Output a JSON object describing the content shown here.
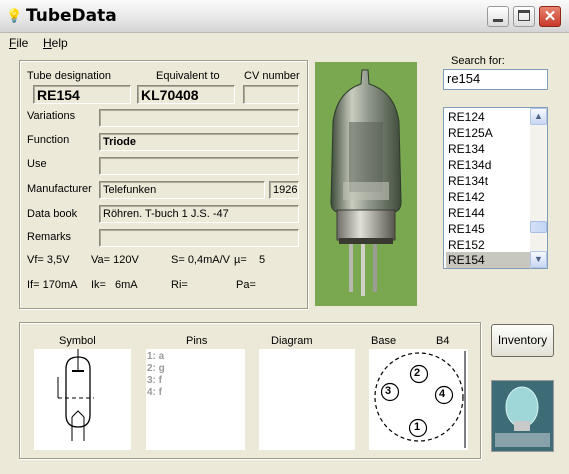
{
  "window": {
    "title": "TubeData"
  },
  "menu": [
    {
      "label": "File",
      "mnemonic": "F",
      "rest": "ile"
    },
    {
      "label": "Help",
      "mnemonic": "H",
      "rest": "elp"
    }
  ],
  "header_labels": {
    "designation": "Tube designation",
    "equivalent": "Equivalent to",
    "cv": "CV number"
  },
  "fields": {
    "designation": "RE154",
    "equivalent": "KL70408",
    "cv_number": "",
    "variations": "",
    "function": "Triode",
    "use": "",
    "manufacturer": "Telefunken",
    "year": "1926",
    "data_book": "Röhren. T-buch 1 J.S. -47",
    "remarks": ""
  },
  "field_labels": {
    "variations": "Variations",
    "function": "Function",
    "use": "Use",
    "manufacturer": "Manufacturer",
    "data_book": "Data book",
    "remarks": "Remarks"
  },
  "params": {
    "vf": "Vf= 3,5V",
    "va": "Va= 120V",
    "s": "S= 0,4mA/V",
    "mu": "µ=",
    "mu_val": "5",
    "if": "If= 170mA",
    "ik": "Ik=",
    "ik_val": "6mA",
    "ri": "Ri=",
    "pa": "Pa="
  },
  "search": {
    "label": "Search for:",
    "value": "re154"
  },
  "tube_list": [
    "RE124",
    "RE125A",
    "RE134",
    "RE134d",
    "RE134t",
    "RE142",
    "RE144",
    "RE145",
    "RE152",
    "RE154"
  ],
  "selected_index": 9,
  "bottom": {
    "symbol_label": "Symbol",
    "pins_label": "Pins",
    "diagram_label": "Diagram",
    "base_label": "Base",
    "base_type": "B4",
    "pins": [
      "1: a",
      "2: g",
      "3: f",
      "4: f"
    ],
    "base_pin_numbers": [
      "1",
      "2",
      "3",
      "4"
    ]
  },
  "buttons": {
    "inventory": "Inventory"
  },
  "icons": {
    "app": "lightbulb-icon",
    "minimize": "minimize-icon",
    "maximize": "maximize-icon",
    "close": "close-icon"
  },
  "colors": {
    "close_button": "#c8392a",
    "photo_bg": "#7aa850",
    "list_selection": "#c8c7bf"
  }
}
